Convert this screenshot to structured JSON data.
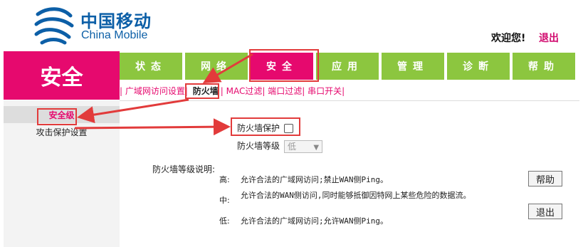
{
  "header": {
    "logo_cn": "中国移动",
    "logo_en": "China Mobile",
    "welcome": "欢迎您!",
    "logout": "退出"
  },
  "section_title": "安全",
  "nav": {
    "tabs": [
      {
        "label": "状态"
      },
      {
        "label": "网络"
      },
      {
        "label": "安全",
        "active": true
      },
      {
        "label": "应用"
      },
      {
        "label": "管理"
      },
      {
        "label": "诊断"
      },
      {
        "label": "帮助"
      }
    ]
  },
  "subnav": {
    "items": [
      "广域网访问设置",
      "防火墙",
      "MAC过滤",
      "端口过滤",
      "串口开关"
    ],
    "active": "防火墙"
  },
  "left_menu": {
    "items": [
      "安全级",
      "攻击保护设置"
    ],
    "active": "安全级"
  },
  "firewall": {
    "protect_label": "防火墙保护",
    "protect_checked": false,
    "level_label": "防火墙等级",
    "level_value": "低",
    "desc_title": "防火墙等级说明:",
    "levels": [
      {
        "name": "高:",
        "text": "允许合法的广域网访问;禁止WAN侧Ping。"
      },
      {
        "name": "中:",
        "text": "允许合法的WAN侧访问,同时能够抵御因特网上某些危险的数据流。"
      },
      {
        "name": "低:",
        "text": "允许合法的广域网访问;允许WAN侧Ping。"
      }
    ]
  },
  "buttons": {
    "help": "帮助",
    "exit": "退出"
  },
  "colors": {
    "brand_blue": "#0c5fa7",
    "brand_pink": "#e6096e",
    "nav_green": "#8cc63f",
    "annotation_red": "#e23b3b"
  }
}
